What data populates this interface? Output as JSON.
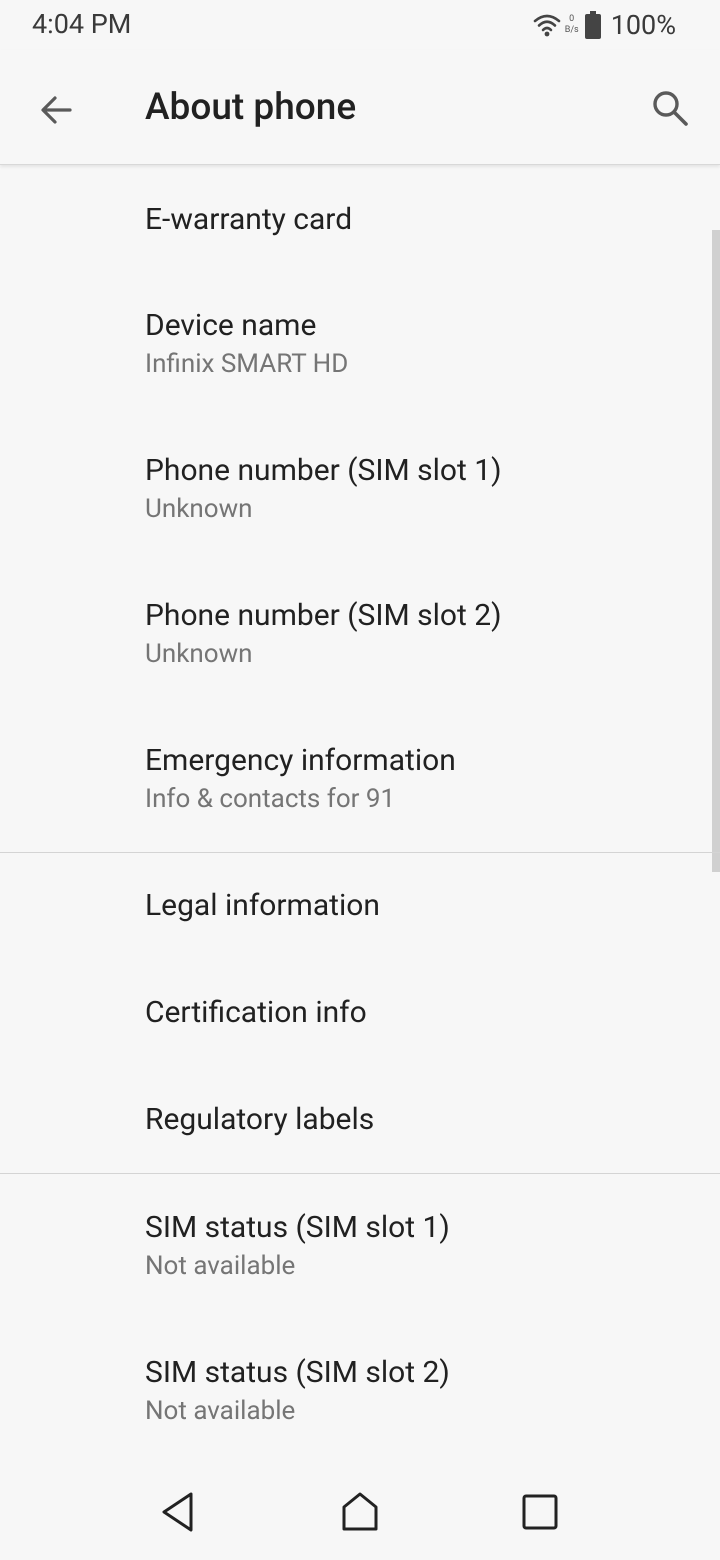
{
  "status_bar": {
    "time": "4:04 PM",
    "speed_value": "0",
    "speed_unit": "B/s",
    "battery": "100%",
    "icons": [
      "wifi-icon",
      "battery-icon"
    ]
  },
  "app_bar": {
    "title": "About phone",
    "back_icon": "arrow-back-icon",
    "search_icon": "search-icon"
  },
  "items": [
    {
      "title": "E-warranty card",
      "subtitle": ""
    },
    {
      "title": "Device name",
      "subtitle": "Infinix SMART HD"
    },
    {
      "title": "Phone number (SIM slot 1)",
      "subtitle": "Unknown"
    },
    {
      "title": "Phone number (SIM slot 2)",
      "subtitle": "Unknown"
    },
    {
      "title": "Emergency information",
      "subtitle": "Info & contacts for 91"
    },
    {
      "title": "Legal information",
      "subtitle": ""
    },
    {
      "title": "Certification info",
      "subtitle": ""
    },
    {
      "title": "Regulatory labels",
      "subtitle": ""
    },
    {
      "title": "SIM status (SIM slot 1)",
      "subtitle": "Not available"
    },
    {
      "title": "SIM status (SIM slot 2)",
      "subtitle": "Not available"
    }
  ],
  "nav_bar": {
    "back": "nav-back-icon",
    "home": "nav-home-icon",
    "recents": "nav-recents-icon"
  },
  "colors": {
    "background": "#f7f7f7",
    "title_text": "#212121",
    "subtitle_text": "#757575",
    "divider": "#d4d4d4"
  }
}
